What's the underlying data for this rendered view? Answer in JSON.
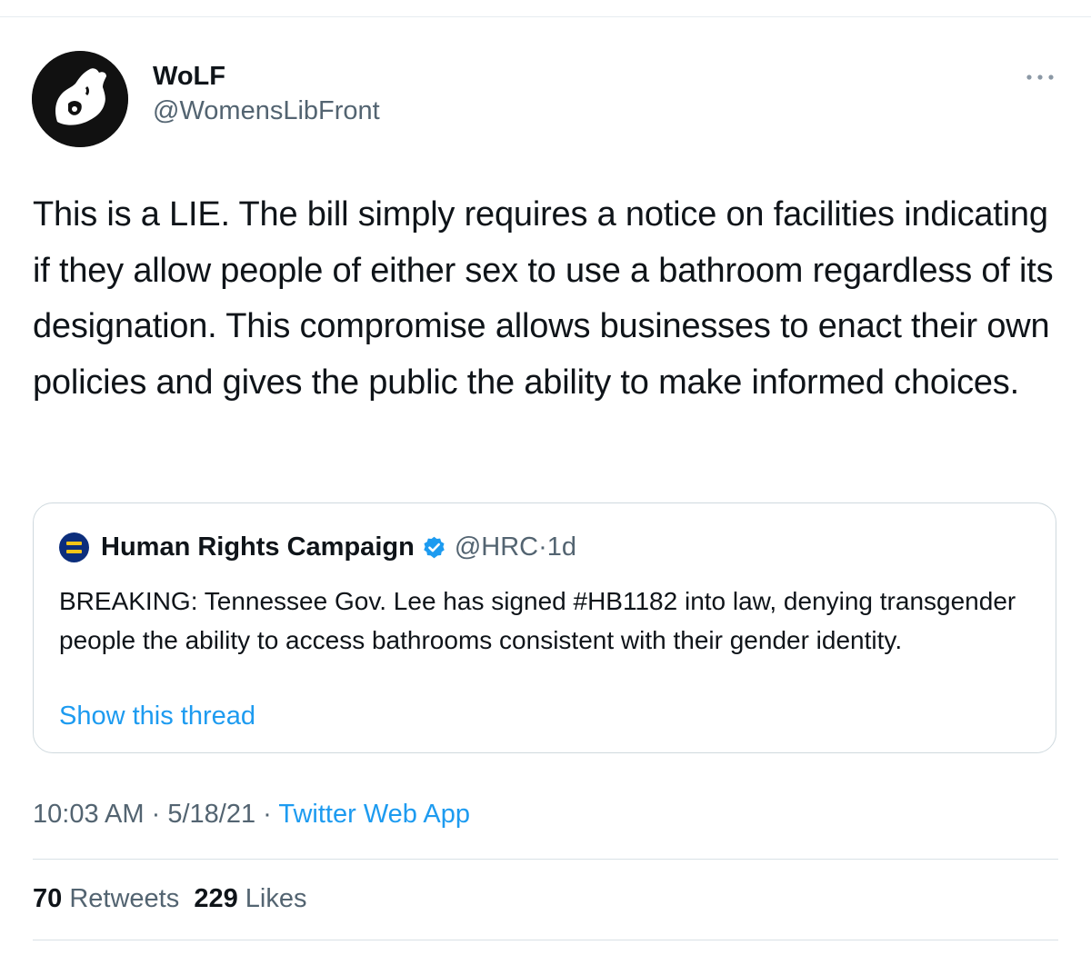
{
  "tweet": {
    "author": {
      "display_name": "WoLF",
      "handle": "@WomensLibFront",
      "avatar_icon": "wolf-logo-icon"
    },
    "more_icon": "more-dots-icon",
    "text": "This is a LIE. The bill simply requires a notice on facilities indicating if they allow people of either sex to use a bathroom regardless of its designation. This compromise allows businesses to enact their own policies and gives the public the ability to make informed choices.",
    "quoted_tweet": {
      "author_name": "Human Rights Campaign",
      "verified_icon": "verified-badge-icon",
      "handle": "@HRC",
      "separator": "·",
      "time": "1d",
      "text": "BREAKING: Tennessee Gov. Lee has signed #HB1182 into law, denying transgender people the ability to access bathrooms consistent with their gender identity.",
      "show_thread": "Show this thread"
    },
    "meta": {
      "time": "10:03 AM",
      "separator": "·",
      "date": "5/18/21",
      "source": "Twitter Web App"
    },
    "stats": {
      "retweets_count": "70",
      "retweets_label": "Retweets",
      "likes_count": "229",
      "likes_label": "Likes"
    }
  },
  "colors": {
    "text": "#0f1419",
    "secondary": "#536471",
    "link": "#1d9bf0",
    "hrc_blue": "#0c2e7c",
    "hrc_yellow": "#f5c518"
  }
}
